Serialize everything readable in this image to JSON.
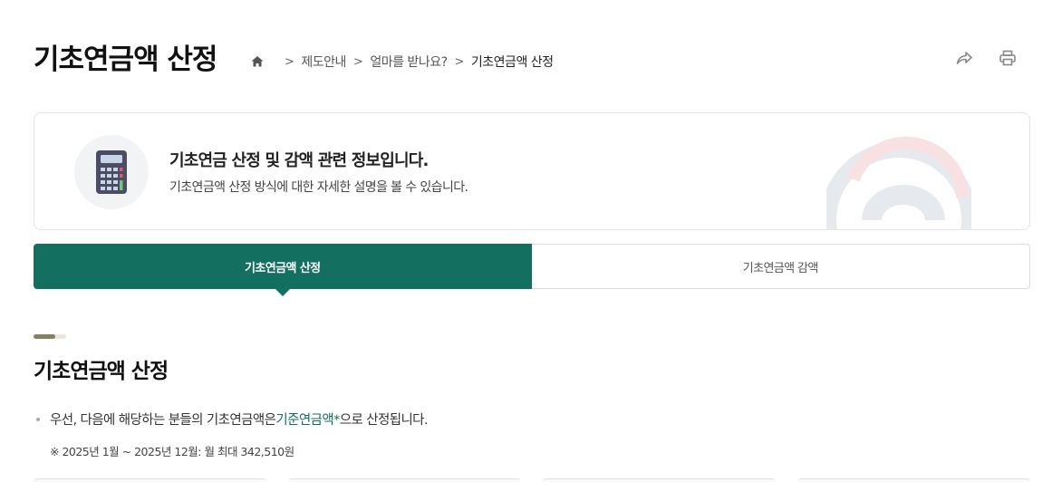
{
  "header": {
    "title": "기초연금액 산정",
    "breadcrumb": [
      "제도안내",
      "얼마를 받나요?",
      "기초연금액 산정"
    ]
  },
  "icons": {
    "home": "home-icon",
    "share": "share-icon",
    "print": "print-icon",
    "info": "calculator-icon",
    "decoration": "taegeuk-emblem-icon"
  },
  "info_box": {
    "title": "기초연금 산정 및 감액 관련 정보입니다.",
    "description": "기초연금액 산정 방식에 대한 자세한 설명을 볼 수 있습니다."
  },
  "tabs": [
    {
      "label": "기초연금액 산정",
      "active": true
    },
    {
      "label": "기초연금액 감액",
      "active": false
    }
  ],
  "section": {
    "title": "기초연금액 산정",
    "bullet_prefix": "우선, 다음에 해당하는 분들의 기초연금액은 ",
    "bullet_highlight": "기준연금액*",
    "bullet_suffix": "으로 산정됩니다.",
    "note": "※ 2025년 1월 ~ 2025년 12월: 월 최대 342,510원"
  },
  "colors": {
    "accent": "#136f5f",
    "section_bar": "#8a7d62"
  }
}
